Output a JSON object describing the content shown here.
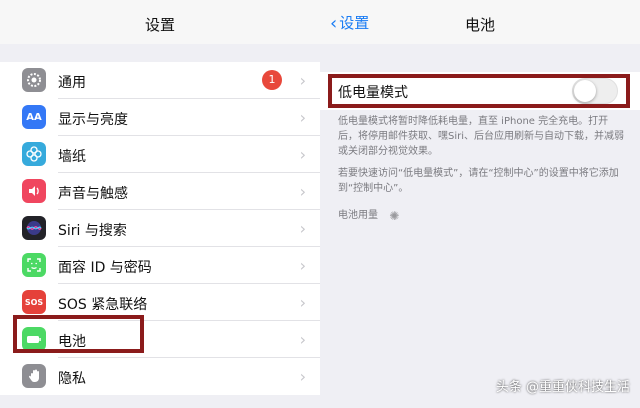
{
  "left": {
    "title": "设置",
    "items": [
      {
        "label": "通用",
        "icon": "gear-icon",
        "color": "#8e8e93",
        "badge": "1"
      },
      {
        "label": "显示与亮度",
        "icon": "display-icon",
        "color": "#3478f6",
        "glyph": "AA"
      },
      {
        "label": "墙纸",
        "icon": "wallpaper-icon",
        "color": "#36aadc"
      },
      {
        "label": "声音与触感",
        "icon": "sound-icon",
        "color": "#f0465f"
      },
      {
        "label": "Siri 与搜索",
        "icon": "siri-icon",
        "color": "#222228"
      },
      {
        "label": "面容 ID 与密码",
        "icon": "faceid-icon",
        "color": "#4cd964"
      },
      {
        "label": "SOS 紧急联络",
        "icon": "sos-icon",
        "color": "#e5413a",
        "glyph": "SOS"
      },
      {
        "label": "电池",
        "icon": "battery-icon",
        "color": "#4cd964"
      },
      {
        "label": "隐私",
        "icon": "privacy-hand-icon",
        "color": "#8e8e93"
      }
    ]
  },
  "right": {
    "back_label": "设置",
    "title": "电池",
    "low_power_label": "低电量模式",
    "low_power_on": false,
    "desc1": "低电量模式将暂时降低耗电量，直至 iPhone 完全充电。打开后，将停用邮件获取、嘿Siri、后台应用刷新与自动下载，并减弱或关闭部分视觉效果。",
    "desc2": "若要快速访问“低电量模式”，请在“控制中心”的设置中将它添加到“控制中心”。",
    "usage_label": "电池用量"
  },
  "watermark": "头条 @重重侠科技生活"
}
